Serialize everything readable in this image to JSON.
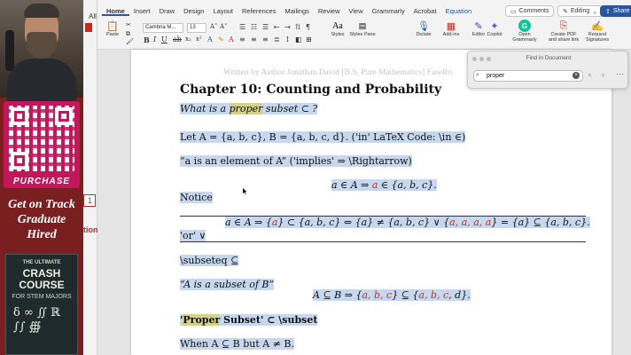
{
  "ribbon": {
    "tabs": [
      "Home",
      "Insert",
      "Draw",
      "Design",
      "Layout",
      "References",
      "Mailings",
      "Review",
      "View",
      "Grammarly",
      "Acrobat",
      "Equation"
    ],
    "comments_label": "Comments",
    "editing_label": "Editing",
    "share_label": "Share",
    "paste_label": "Paste",
    "font_name": "Cambria M...",
    "font_size": "13",
    "styles_label": "Styles",
    "styles_pane_label": "Styles Pane",
    "dictate_label": "Dictate",
    "addins_label": "Add-ins",
    "editor_label": "Editor",
    "copilot_label": "Copilot",
    "open_grammarly_label": "Open Grammarly",
    "create_pdf_label": "Create PDF and share link",
    "request_sig_label": "Request Signatures"
  },
  "sidebar": {
    "edge_all": "All",
    "edge_box_num": "1",
    "edge_word": "tion"
  },
  "promo": {
    "qr_label": "PURCHASE",
    "tagline": [
      "Get on Track",
      "Graduate",
      "Hired"
    ],
    "book_top": "THE ULTIMATE",
    "book_title": "CRASH COURSE",
    "book_sub": "FOR STEM MAJORS",
    "book_symbols": "δ ∞ ∬ ℝ ∫∫ ∰"
  },
  "find": {
    "title": "Find in Document",
    "query": "proper"
  },
  "document": {
    "header": "Written by Author Jonathan David [B.S. Pure Mathematics] FaseRo",
    "chapter": "Chapter 10: Counting and Probability",
    "q_pre": "What is a ",
    "q_hl": "proper",
    "q_post": " subset ⊂ ?",
    "let_line": "Let A = {a, b, c},  B = {a, b, c, d}.     ('in' LaTeX Code: \\in ∈)",
    "quote_pre": "“a is an element of A” ('implies' ⇒ \\Rightarrow)",
    "impl_a": "a ∈ A  ⇒  ",
    "impl_red": "a",
    "impl_b": " ∈ {a, b, c}.",
    "notice": "Notice",
    "long_a": "a ∈ A  ⇒  {",
    "long_red1": "a",
    "long_b": "} ⊂ {a, b, c} ⇔ {a} ≠ {a, b, c} ∨ {",
    "long_red2": "a, a, a, a",
    "long_c": "} = {a} ⊆ {a, b, c}.",
    "or_line": "'or' ∨",
    "subseteq_line": "\\subseteq ⊆",
    "subset_quote": "“A is a subset of B”",
    "sub_a": "A ⊆ B  ⇒  {",
    "sub_red1": "a, b, c",
    "sub_b": "} ⊆ {",
    "sub_red2": "a, b, c",
    "sub_c": ", d}.",
    "proper_pre": "'",
    "proper_hl": "Proper",
    "proper_post": " Subset' ⊂ \\subset",
    "when_line": "When A ⊆ B but A ≠ B."
  },
  "colors": {
    "accent": "#2b579a",
    "highlight": "#d4d18a",
    "selection": "#c7d7ee",
    "math_red": "#c42b1c"
  }
}
